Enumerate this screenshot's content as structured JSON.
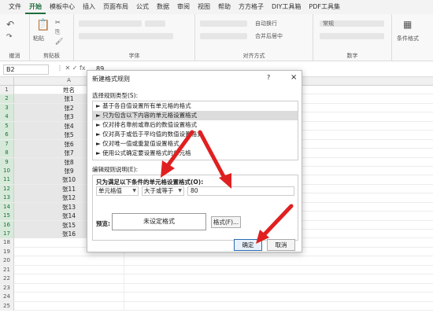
{
  "tabs": [
    "文件",
    "开始",
    "模板中心",
    "插入",
    "页面布局",
    "公式",
    "数据",
    "审阅",
    "视图",
    "帮助",
    "方方格子",
    "DIY工具箱",
    "PDF工具集"
  ],
  "active_tab": "开始",
  "ribbon": {
    "undo_label": "撤消",
    "clipboard_label": "剪贴板",
    "paste_label": "粘贴",
    "font_label": "字体",
    "align_label": "对齐方式",
    "wrap_label": "自动换行",
    "merge_label": "合并后居中",
    "number_label": "数字",
    "number_format": "常规",
    "cond_format_label": "条件格式"
  },
  "formula_bar": {
    "name_box": "B2",
    "fx": "fx",
    "value": "89"
  },
  "grid": {
    "column_header": "A",
    "rows": [
      {
        "num": "1",
        "value": "姓名"
      },
      {
        "num": "2",
        "value": "张1"
      },
      {
        "num": "3",
        "value": "张2"
      },
      {
        "num": "4",
        "value": "张3"
      },
      {
        "num": "5",
        "value": "张4"
      },
      {
        "num": "6",
        "value": "张5"
      },
      {
        "num": "7",
        "value": "张6"
      },
      {
        "num": "8",
        "value": "张7"
      },
      {
        "num": "9",
        "value": "张8"
      },
      {
        "num": "10",
        "value": "张9"
      },
      {
        "num": "11",
        "value": "张10"
      },
      {
        "num": "12",
        "value": "张11"
      },
      {
        "num": "13",
        "value": "张12"
      },
      {
        "num": "14",
        "value": "张13"
      },
      {
        "num": "15",
        "value": "张14"
      },
      {
        "num": "16",
        "value": "张15"
      },
      {
        "num": "17",
        "value": "张16"
      },
      {
        "num": "18",
        "value": ""
      },
      {
        "num": "19",
        "value": ""
      },
      {
        "num": "20",
        "value": ""
      },
      {
        "num": "21",
        "value": ""
      },
      {
        "num": "22",
        "value": ""
      },
      {
        "num": "23",
        "value": ""
      },
      {
        "num": "24",
        "value": ""
      },
      {
        "num": "25",
        "value": ""
      }
    ]
  },
  "dialog": {
    "title": "新建格式规则",
    "help": "?",
    "close": "×",
    "select_type_label": "选择规则类型(S):",
    "rule_types": [
      "► 基于各自值设置所有单元格的格式",
      "► 只为包含以下内容的单元格设置格式",
      "► 仅对排名靠前或靠后的数值设置格式",
      "► 仅对高于或低于平均值的数值设置格式",
      "► 仅对唯一值或重复值设置格式",
      "► 使用公式确定要设置格式的单元格"
    ],
    "edit_desc_label": "编辑规则说明(E):",
    "condition_label": "只为满足以下条件的单元格设置格式(O):",
    "cell_value_option": "单元格值",
    "operator_option": "大于或等于",
    "value_input": "80",
    "preview_label": "预览:",
    "preview_text": "未设定格式",
    "format_button": "格式(F)...",
    "ok_button": "确定",
    "cancel_button": "取消"
  },
  "colors": {
    "accent": "#1e6e3e",
    "arrow": "#e02020"
  }
}
